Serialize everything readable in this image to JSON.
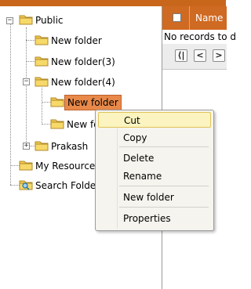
{
  "tree": {
    "nodes": [
      {
        "id": "public",
        "label": "Public",
        "expander": "−"
      },
      {
        "id": "new-folder",
        "label": "New folder"
      },
      {
        "id": "new-folder-3",
        "label": "New folder(3)"
      },
      {
        "id": "new-folder-4",
        "label": "New folder(4)",
        "expander": "−"
      },
      {
        "id": "new-folder-selected",
        "label": "New folder",
        "selected": true
      },
      {
        "id": "new-folder-partial",
        "label": "New fo"
      },
      {
        "id": "prakash",
        "label": "Prakash",
        "expander": "+"
      },
      {
        "id": "my-resources",
        "label": "My Resources"
      },
      {
        "id": "search-folder",
        "label": "Search Folder"
      }
    ]
  },
  "grid": {
    "column_name": "Name",
    "empty_text": "No records to d",
    "pager": {
      "first": "⟨|",
      "prev": "<",
      "next": ">"
    }
  },
  "context_menu": {
    "items": [
      {
        "id": "cut",
        "label": "Cut",
        "highlighted": true
      },
      {
        "id": "copy",
        "label": "Copy"
      },
      {
        "id": "delete",
        "label": "Delete"
      },
      {
        "id": "rename",
        "label": "Rename"
      },
      {
        "id": "new-folder",
        "label": "New folder"
      },
      {
        "id": "properties",
        "label": "Properties"
      }
    ]
  },
  "colors": {
    "accent_orange": "#cf6a22",
    "selection": "#e8894a",
    "menu_hover": "#fbf4c0",
    "folder_yellow": "#f2c94c"
  }
}
